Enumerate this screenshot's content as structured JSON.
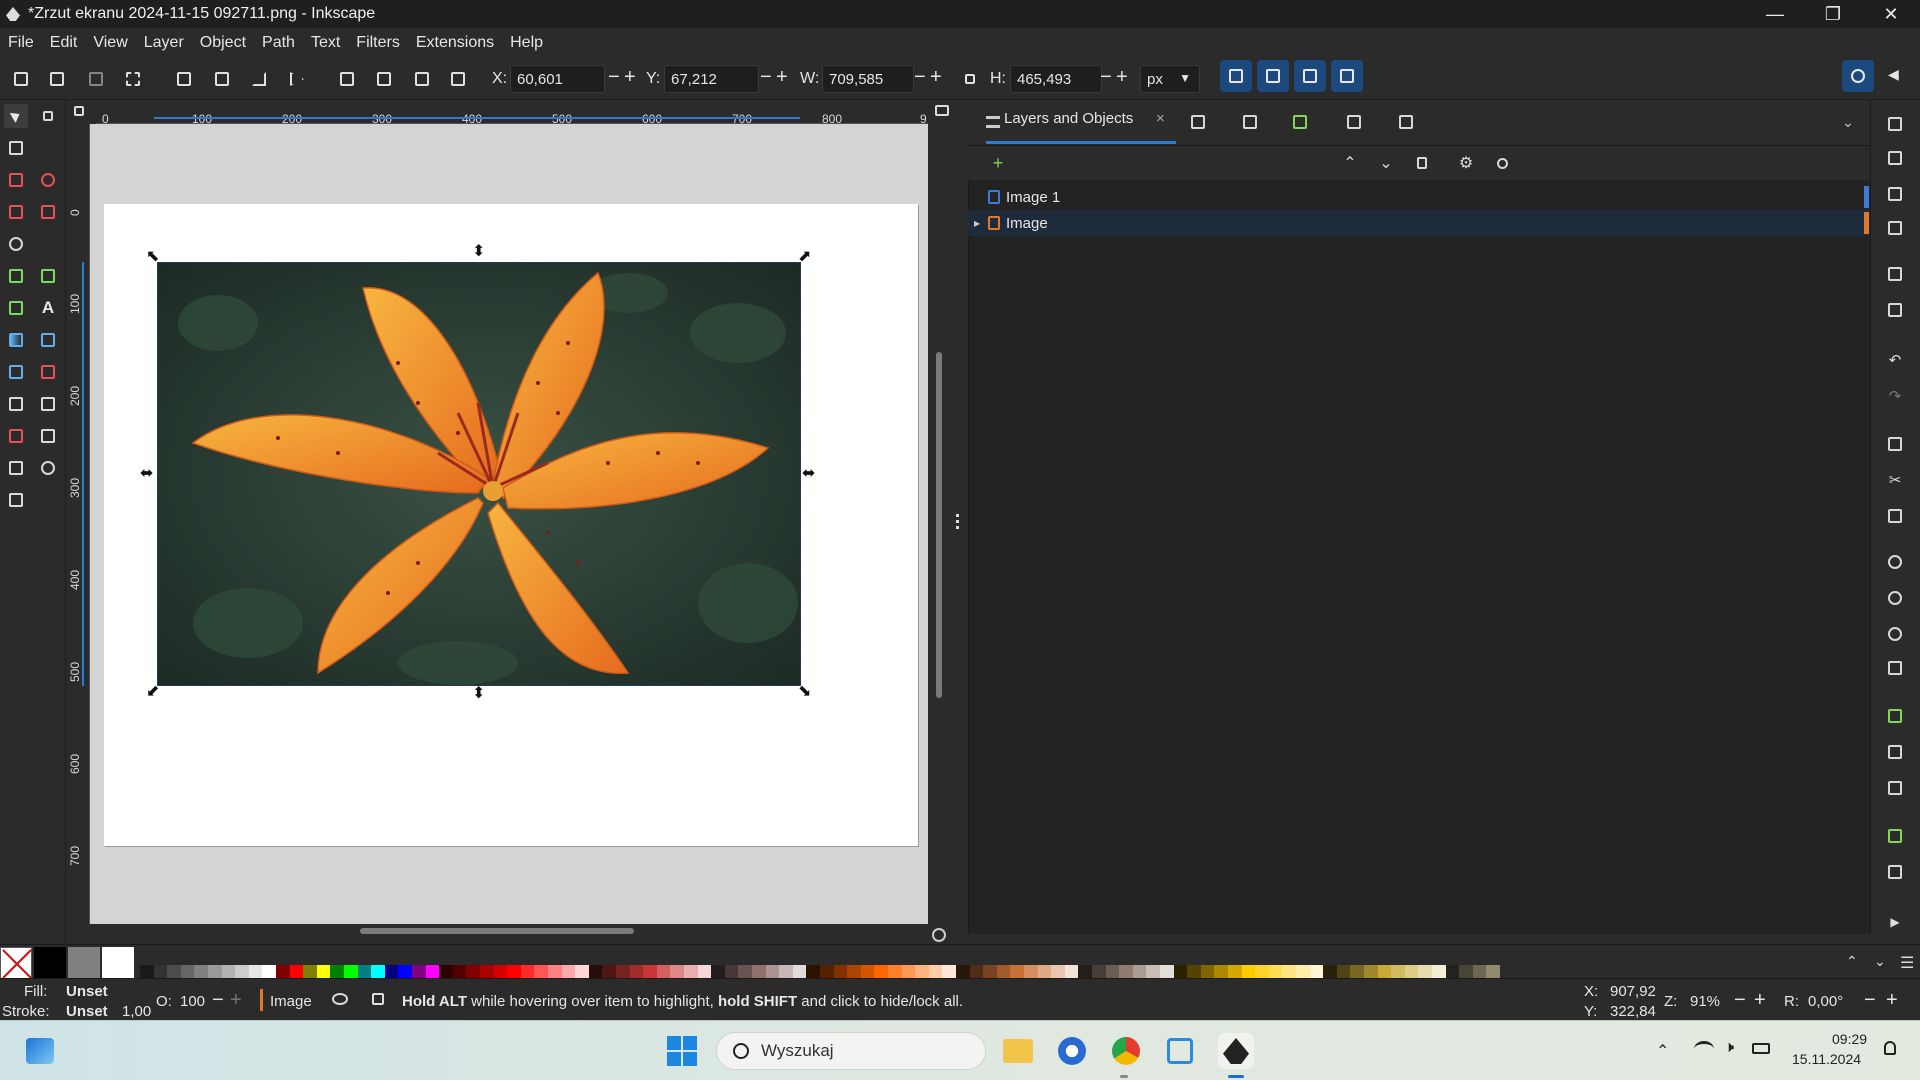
{
  "window": {
    "title": "*Zrzut ekranu 2024-11-15 092711.png - Inkscape",
    "app_icon": "inkscape-icon",
    "controls": [
      "minimize-icon",
      "restore-icon",
      "close-icon"
    ]
  },
  "menubar": {
    "items": [
      "File",
      "Edit",
      "View",
      "Layer",
      "Object",
      "Path",
      "Text",
      "Filters",
      "Extensions",
      "Help"
    ]
  },
  "toolbar": {
    "x_label": "X:",
    "x_value": "60,601",
    "y_label": "Y:",
    "y_value": "67,212",
    "w_label": "W:",
    "w_value": "709,585",
    "h_label": "H:",
    "h_value": "465,493",
    "unit": "px",
    "minus": "−",
    "plus": "+"
  },
  "rulers": {
    "horizontal": [
      "0",
      "100",
      "200",
      "300",
      "400",
      "500",
      "600",
      "700",
      "800",
      "9"
    ],
    "vertical": [
      "0",
      "100",
      "200",
      "300",
      "400",
      "500",
      "600",
      "700"
    ]
  },
  "dock": {
    "tab_label": "Layers and Objects",
    "tab_close": "×",
    "layers": [
      {
        "label": "Image 1",
        "color": "#3a7bdc",
        "expander": ""
      },
      {
        "label": "Image",
        "color": "#e07a2a",
        "expander": "▸"
      }
    ]
  },
  "palette": {
    "greys": [
      "#000000",
      "#808080",
      "#ffffff"
    ],
    "strip": [
      "#1a1a1a",
      "#333333",
      "#4d4d4d",
      "#666666",
      "#808080",
      "#999999",
      "#b3b3b3",
      "#cccccc",
      "#e6e6e6",
      "#ffffff",
      "#800000",
      "#ff0000",
      "#808000",
      "#ffff00",
      "#008000",
      "#00ff00",
      "#008080",
      "#00ffff",
      "#000080",
      "#0000ff",
      "#800080",
      "#ff00ff",
      "#2b0000",
      "#550000",
      "#800000",
      "#aa0000",
      "#d40000",
      "#ff0000",
      "#ff2a2a",
      "#ff5555",
      "#ff8080",
      "#ffaaaa",
      "#ffd5d5",
      "#280b0b",
      "#501616",
      "#782121",
      "#a02c2c",
      "#c83737",
      "#d35f5f",
      "#de8787",
      "#e9afaf",
      "#f4d7d7",
      "#241c1c",
      "#483737",
      "#6c5353",
      "#916f6f",
      "#ac9393",
      "#c8b7b7",
      "#e3dbdb",
      "#2b1100",
      "#552200",
      "#803300",
      "#aa4400",
      "#d45500",
      "#ff6600",
      "#ff7f2a",
      "#ff9955",
      "#ffb380",
      "#ffccaa",
      "#ffe6d5",
      "#28170b",
      "#502d16",
      "#784421",
      "#a05a2c",
      "#c87137",
      "#d38d5f",
      "#deaa87",
      "#e9c6af",
      "#f4e3d7",
      "#241f1c",
      "#483e37",
      "#6c5d53",
      "#917c6f",
      "#ac9d93",
      "#c8beb7",
      "#e3dedb",
      "#2b2200",
      "#554400",
      "#806600",
      "#aa8800",
      "#d4aa00",
      "#ffcc00",
      "#ffd42a",
      "#ffdd55",
      "#ffe680",
      "#ffeeaa",
      "#fff6d5",
      "#28220b",
      "#504416",
      "#786721",
      "#a0892c",
      "#c8ab37",
      "#d3bc5f",
      "#decd87",
      "#e9ddaf",
      "#f4eed7",
      "#24221c",
      "#484537",
      "#6c6753",
      "#918a6f"
    ]
  },
  "statusbar": {
    "fill_label": "Fill:",
    "fill_value": "Unset",
    "stroke_label": "Stroke:",
    "stroke_value": "Unset",
    "stroke_width": "1,00",
    "opacity_label": "O:",
    "opacity_value": "100",
    "layer_name": "Image",
    "message_bold1": "Hold ALT",
    "message_mid": " while hovering over item to highlight, ",
    "message_bold2": "hold SHIFT",
    "message_end": " and click to hide/lock all.",
    "cursor_x_label": "X:",
    "cursor_x": "907,92",
    "cursor_y_label": "Y:",
    "cursor_y": "322,84",
    "zoom_label": "Z:",
    "zoom": "91%",
    "rotation_label": "R:",
    "rotation": "0,00°"
  },
  "taskbar": {
    "search_placeholder": "Wyszukaj",
    "time": "09:29",
    "date": "15.11.2024"
  }
}
